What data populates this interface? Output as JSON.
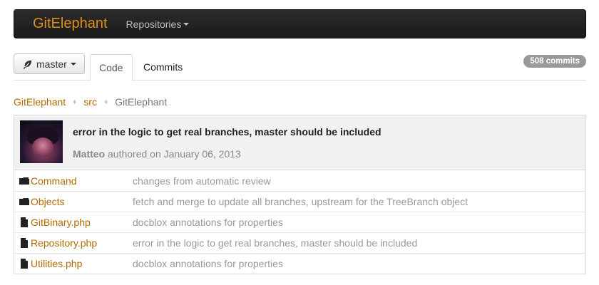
{
  "navbar": {
    "brand": "GitElephant",
    "repositories_label": "Repositories"
  },
  "toolbar": {
    "branch_label": "master",
    "tabs": [
      {
        "label": "Code",
        "active": true
      },
      {
        "label": "Commits",
        "active": false
      }
    ],
    "commits_badge": "508 commits"
  },
  "breadcrumb": {
    "items": [
      "GitElephant",
      "src",
      "GitElephant"
    ],
    "separator": "♦"
  },
  "commit": {
    "message": "error in the logic to get real branches, master should be included",
    "author": "Matteo",
    "authored_text": "authored on January 06, 2013"
  },
  "files": [
    {
      "name": "Command",
      "type": "folder",
      "message": "changes from automatic review"
    },
    {
      "name": "Objects",
      "type": "folder",
      "message": "fetch and merge to update all branches, upstream for the TreeBranch object"
    },
    {
      "name": "GitBinary.php",
      "type": "file",
      "message": "docblox annotations for properties"
    },
    {
      "name": "Repository.php",
      "type": "file",
      "message": "error in the logic to get real branches, master should be included"
    },
    {
      "name": "Utilities.php",
      "type": "file",
      "message": "docblox annotations for properties"
    }
  ],
  "colors": {
    "brand": "#e0901a",
    "link": "#b06b00",
    "navbar_bg": "#222222",
    "badge_bg": "#999999"
  },
  "icons": {
    "branch": "leaf-icon",
    "folder": "folder-icon",
    "file": "file-icon",
    "dropdown": "caret-down-icon"
  }
}
